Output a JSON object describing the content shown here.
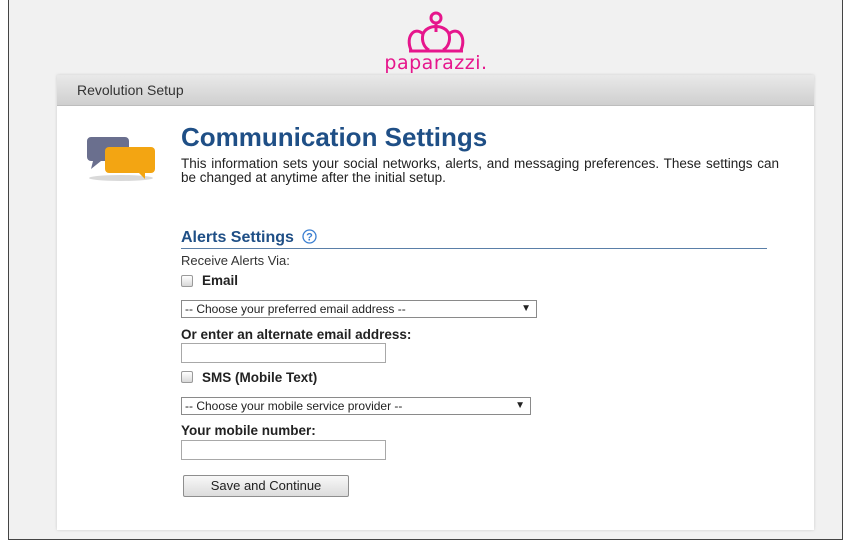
{
  "logo": {
    "text": "paparazzi."
  },
  "panel": {
    "header": "Revolution Setup"
  },
  "page": {
    "title": "Communication Settings",
    "description": "This information sets your social networks, alerts, and messaging preferences. These settings can be changed at anytime after the initial setup."
  },
  "alerts": {
    "heading": "Alerts Settings",
    "receive_label": "Receive Alerts Via:",
    "email_label": "Email",
    "email_select": "-- Choose your preferred email address --",
    "alt_email_label": "Or enter an alternate email address:",
    "alt_email_value": "",
    "sms_label": "SMS (Mobile Text)",
    "provider_select": "-- Choose your mobile service provider --",
    "mobile_label": "Your mobile number:",
    "mobile_value": ""
  },
  "actions": {
    "save_label": "Save and Continue"
  },
  "colors": {
    "brand": "#e6168c",
    "title": "#1f4f86"
  }
}
